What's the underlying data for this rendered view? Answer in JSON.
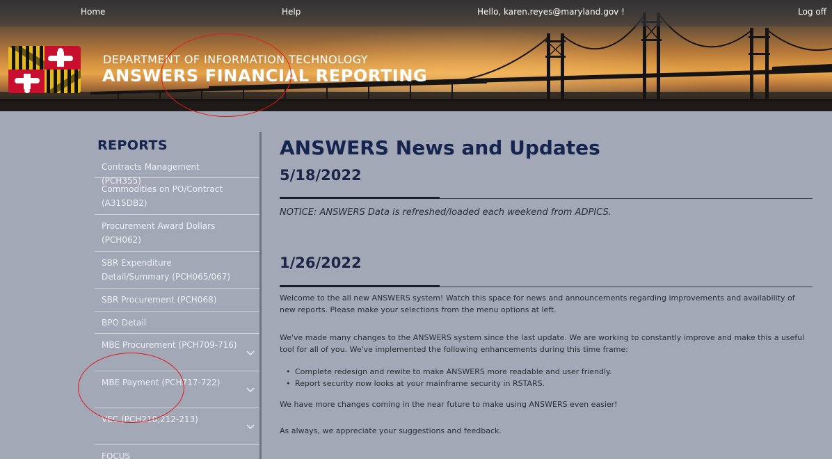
{
  "nav": {
    "home": "Home",
    "help": "Help",
    "greeting": "Hello, karen.reyes@maryland.gov !",
    "logoff": "Log off"
  },
  "header": {
    "department": "DEPARTMENT OF INFORMATION TECHNOLOGY",
    "app_title": "ANSWERS FINANCIAL REPORTING",
    "logo_icon": "maryland-flag-icon"
  },
  "sidebar": {
    "title": "REPORTS",
    "items": [
      {
        "label": "Contracts Management (PCH355)",
        "expandable": false
      },
      {
        "label": "Commodities on PO/Contract (A315DB2)",
        "expandable": false
      },
      {
        "label": "Procurement Award Dollars (PCH062)",
        "expandable": false
      },
      {
        "label": "SBR Expenditure Detail/Summary (PCH065/067)",
        "expandable": false
      },
      {
        "label": "SBR Procurement (PCH068)",
        "expandable": false
      },
      {
        "label": "BPO Detail",
        "expandable": false
      },
      {
        "label": "MBE Procurement (PCH709-716)",
        "expandable": true
      },
      {
        "label": "MBE Payment (PCH717-722)",
        "expandable": true
      },
      {
        "label": "VEC (PCH210,212-213)",
        "expandable": true
      },
      {
        "label": "FOCUS",
        "expandable": false
      }
    ]
  },
  "main": {
    "title": "ANSWERS News and Updates",
    "posts": [
      {
        "date": "5/18/2022",
        "notice": "NOTICE: ANSWERS Data is refreshed/loaded each weekend from ADPICS."
      },
      {
        "date": "1/26/2022",
        "paragraphs": [
          "Welcome to the all new ANSWERS system! Watch this space for news and announcements regarding improvements and availability of new reports. Please make your selections from the menu options at left.",
          "We've made many changes to the ANSWERS system since the last update. We are working to constantly improve and make this a useful tool for all of you. We've implemented the following enhancements during this time frame:"
        ],
        "bullets": [
          "Complete redesign and rewite to make ANSWERS more readable and user friendly.",
          "Report security now looks at your mainframe security in RSTARS."
        ],
        "closing": [
          "We have more changes coming in the near future to make using ANSWERS even easier!",
          "As always, we appreciate your suggestions and feedback."
        ]
      }
    ]
  },
  "colors": {
    "page_bg": "#a3a8b6",
    "heading": "#16254f",
    "annotation": "#e0191b"
  }
}
